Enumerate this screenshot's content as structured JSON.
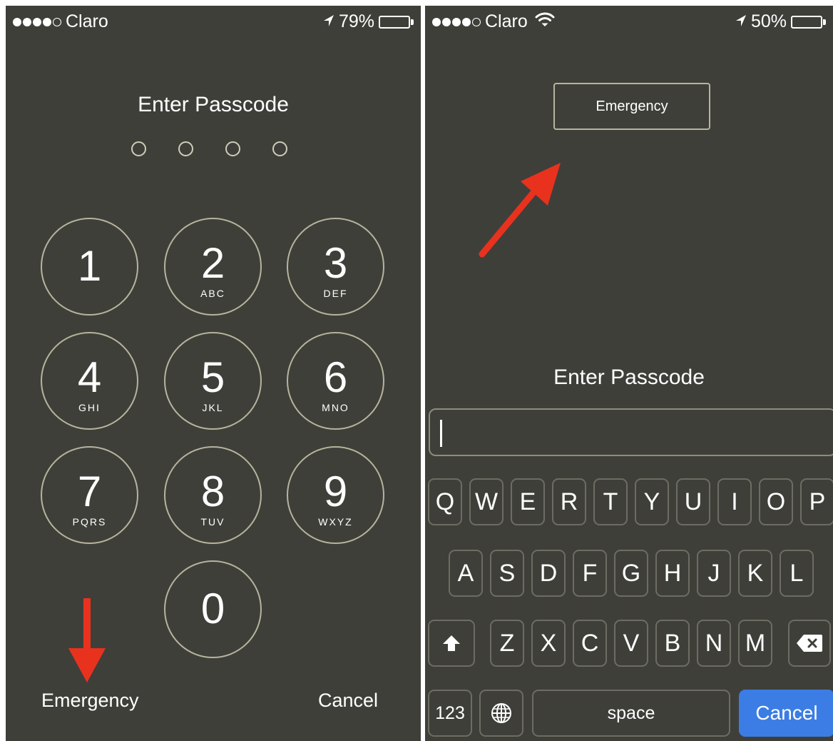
{
  "left_screen": {
    "status": {
      "carrier": "Claro",
      "battery_text": "79%",
      "battery_level": 0.79
    },
    "title": "Enter Passcode",
    "pin_dot_count": 4,
    "keypad": [
      {
        "digit": "1",
        "letters": ""
      },
      {
        "digit": "2",
        "letters": "ABC"
      },
      {
        "digit": "3",
        "letters": "DEF"
      },
      {
        "digit": "4",
        "letters": "GHI"
      },
      {
        "digit": "5",
        "letters": "JKL"
      },
      {
        "digit": "6",
        "letters": "MNO"
      },
      {
        "digit": "7",
        "letters": "PQRS"
      },
      {
        "digit": "8",
        "letters": "TUV"
      },
      {
        "digit": "9",
        "letters": "WXYZ"
      },
      {
        "digit": "0",
        "letters": ""
      }
    ],
    "emergency": "Emergency",
    "cancel": "Cancel",
    "arrow_color": "#e8321e"
  },
  "right_screen": {
    "status": {
      "carrier": "Claro",
      "battery_text": "50%",
      "battery_level": 0.5
    },
    "emergency_button": "Emergency",
    "title": "Enter Passcode",
    "keyboard": {
      "row1": [
        "Q",
        "W",
        "E",
        "R",
        "T",
        "Y",
        "U",
        "I",
        "O",
        "P"
      ],
      "row2": [
        "A",
        "S",
        "D",
        "F",
        "G",
        "H",
        "J",
        "K",
        "L"
      ],
      "row3": [
        "Z",
        "X",
        "C",
        "V",
        "B",
        "N",
        "M"
      ],
      "numbers_key": "123",
      "space_key": "space",
      "cancel_key": "Cancel"
    },
    "arrow_color": "#e8321e",
    "accent": "#3b7de4"
  }
}
